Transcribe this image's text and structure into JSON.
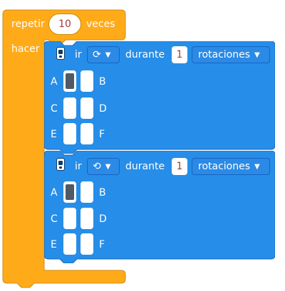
{
  "loop": {
    "repeat_label": "repetir",
    "count": "10",
    "times_label": "veces",
    "do_label": "hacer"
  },
  "blocks": [
    {
      "verb": "ir",
      "direction_icon": "clockwise-icon",
      "direction_glyph": "⟳",
      "during_label": "durante",
      "amount": "1",
      "unit": "rotaciones",
      "ports": {
        "a": "A",
        "b": "B",
        "c": "C",
        "d": "D",
        "e": "E",
        "f": "F"
      },
      "selected_port": "A"
    },
    {
      "verb": "ir",
      "direction_icon": "counterclockwise-icon",
      "direction_glyph": "⟲",
      "during_label": "durante",
      "amount": "1",
      "unit": "rotaciones",
      "ports": {
        "a": "A",
        "b": "B",
        "c": "C",
        "d": "D",
        "e": "E",
        "f": "F"
      },
      "selected_port": "A"
    }
  ],
  "colors": {
    "loop": "#ffab19",
    "loop_border": "#cf8b17",
    "motion": "#268ee8",
    "motion_border": "#1567c4"
  }
}
